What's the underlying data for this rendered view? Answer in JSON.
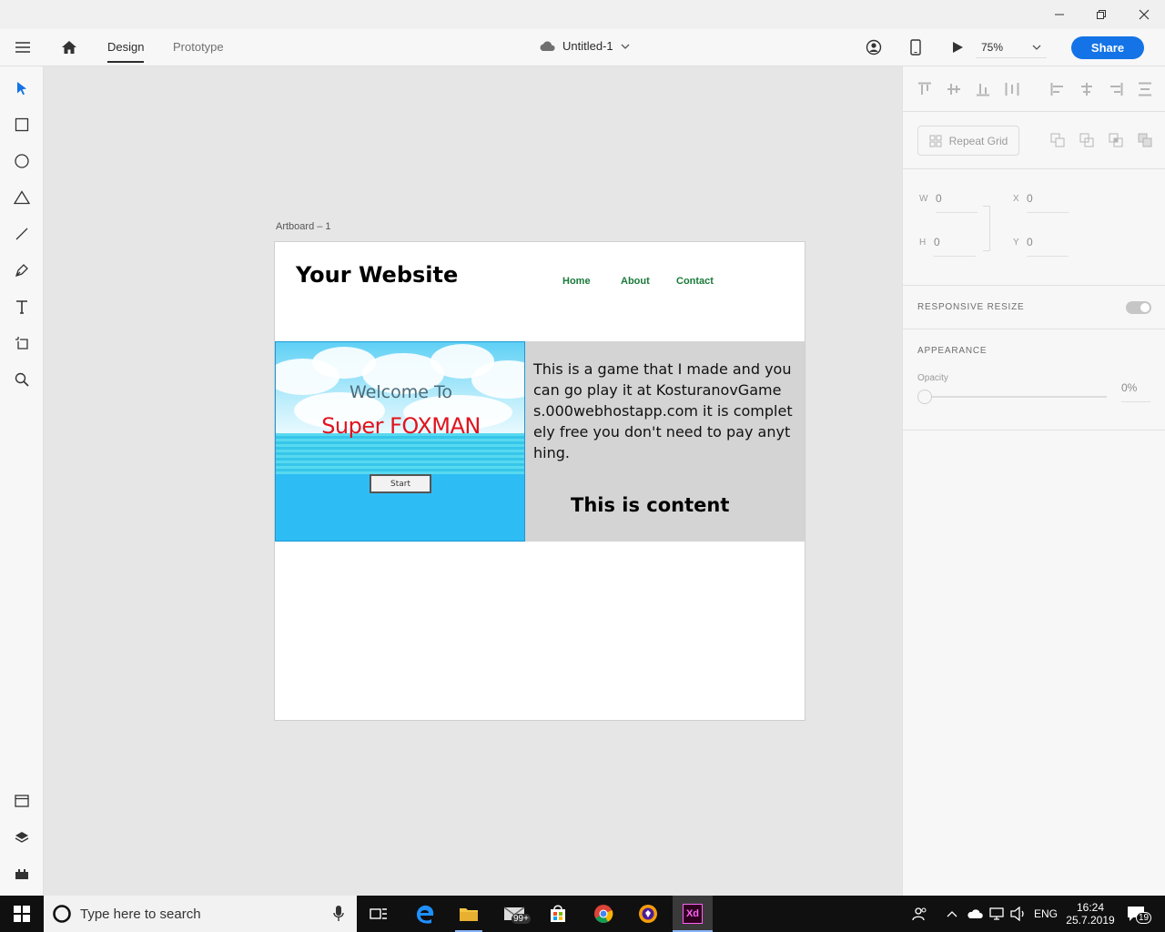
{
  "window": {
    "minimize_icon": "minimize-icon",
    "restore_icon": "restore-icon",
    "close_icon": "close-icon"
  },
  "header": {
    "tabs": [
      {
        "label": "Design",
        "active": true
      },
      {
        "label": "Prototype",
        "active": false
      }
    ],
    "doc_title": "Untitled-1",
    "zoom": "75%",
    "share_label": "Share"
  },
  "tools": [
    "select-tool",
    "rectangle-tool",
    "ellipse-tool",
    "polygon-tool",
    "line-tool",
    "pen-tool",
    "text-tool",
    "artboard-tool",
    "zoom-tool"
  ],
  "bottom_tools": [
    "assets-panel",
    "layers-panel",
    "plugins-panel"
  ],
  "canvas": {
    "artboard_label": "Artboard – 1",
    "site": {
      "title": "Your Website",
      "nav": [
        "Home",
        "About",
        "Contact"
      ],
      "game_welcome": "Welcome To",
      "game_title": "Super FOXMAN",
      "game_start": "Start",
      "description": "This is a game that I made and you can go play it at KosturanovGames.000webhostapp.com it is completely free you don't need to pay anything.",
      "content_label": "This is content"
    }
  },
  "panel": {
    "repeat_grid": "Repeat Grid",
    "w_label": "W",
    "w_value": "0",
    "h_label": "H",
    "h_value": "0",
    "x_label": "X",
    "x_value": "0",
    "y_label": "Y",
    "y_value": "0",
    "responsive_resize": "RESPONSIVE RESIZE",
    "appearance": "APPEARANCE",
    "opacity_label": "Opacity",
    "opacity_value": "0%"
  },
  "taskbar": {
    "search_placeholder": "Type here to search",
    "mail_badge": "99+",
    "language": "ENG",
    "time": "16:24",
    "date": "25.7.2019",
    "notifications": "19"
  },
  "colors": {
    "accent": "#1473e6",
    "nav_green": "#1a7a3a",
    "game_red": "#e0141e"
  }
}
